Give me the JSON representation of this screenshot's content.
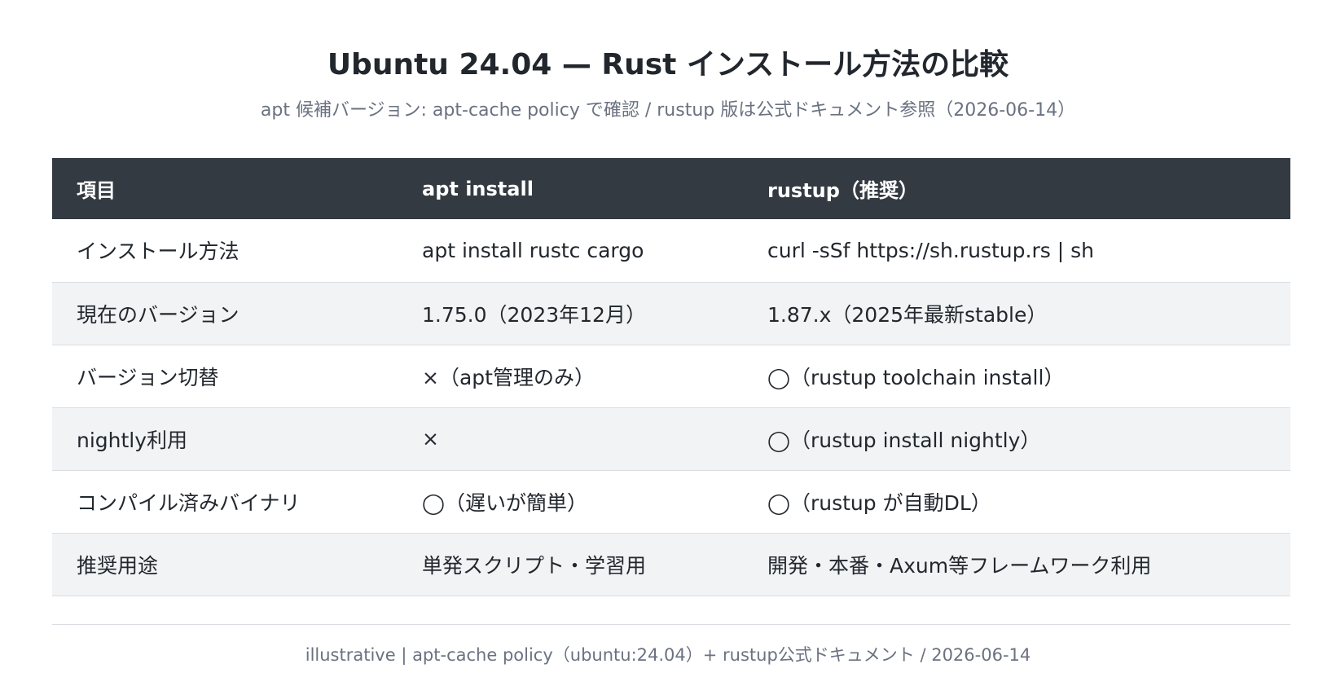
{
  "title": "Ubuntu 24.04 — Rust インストール方法の比較",
  "subtitle": "apt 候補バージョン: apt-cache policy で確認 / rustup 版は公式ドキュメント参照（2026-06-14）",
  "table": {
    "headers": [
      "項目",
      "apt install",
      "rustup（推奨）"
    ],
    "rows": [
      [
        "インストール方法",
        "apt install rustc cargo",
        "curl -sSf https://sh.rustup.rs | sh"
      ],
      [
        "現在のバージョン",
        "1.75.0（2023年12月）",
        "1.87.x（2025年最新stable）"
      ],
      [
        "バージョン切替",
        "×（apt管理のみ）",
        "◯（rustup toolchain install）"
      ],
      [
        "nightly利用",
        "×",
        "◯（rustup install nightly）"
      ],
      [
        "コンパイル済みバイナリ",
        "◯（遅いが簡単）",
        "◯（rustup が自動DL）"
      ],
      [
        "推奨用途",
        "単発スクリプト・学習用",
        "開発・本番・Axum等フレームワーク利用"
      ]
    ]
  },
  "colors": {
    "header_bg": "#343a42",
    "header_text": "#ffffff",
    "alt_row_bg": "#f2f3f5",
    "muted_text": "#6a7280",
    "rule": "#dadde2"
  },
  "footer": "illustrative | apt-cache policy（ubuntu:24.04）+ rustup公式ドキュメント / 2026-06-14"
}
